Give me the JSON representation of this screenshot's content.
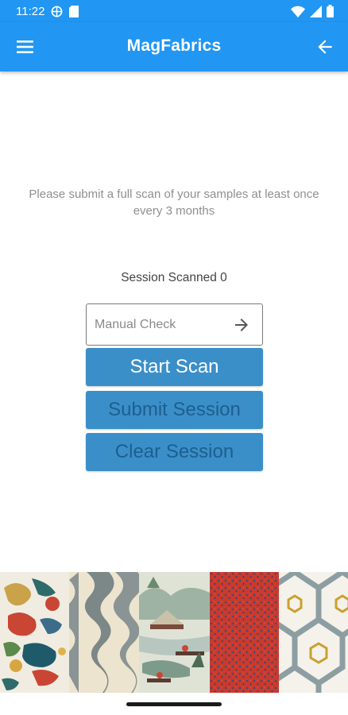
{
  "status_bar": {
    "time": "11:22",
    "icons": [
      "vpn-globe-icon",
      "sd-card-icon",
      "wifi-icon",
      "cell-signal-icon",
      "battery-icon"
    ]
  },
  "app_bar": {
    "title": "MagFabrics",
    "menu_icon": "hamburger-menu-icon",
    "back_icon": "arrow-back-icon"
  },
  "notice": {
    "text": "Please submit a full scan of your samples at least once every 3 months"
  },
  "session": {
    "label": "Session Scanned 0"
  },
  "manual_check": {
    "placeholder": "Manual Check",
    "value": "",
    "submit_icon": "arrow-forward-icon"
  },
  "buttons": {
    "start_scan": "Start Scan",
    "submit_session": "Submit Session",
    "clear_session": "Clear Session"
  },
  "colors": {
    "primary": "#2196f3",
    "button_bg": "#3b8fc9",
    "button_text_active": "#ffffff",
    "button_text_disabled": "#1c5f8e"
  },
  "gallery": {
    "swatches": [
      "chinoiserie-dragon-fabric",
      "grey-wave-fabric",
      "landscape-boat-fabric",
      "red-speckle-fabric",
      "hexagon-trellis-fabric"
    ]
  }
}
